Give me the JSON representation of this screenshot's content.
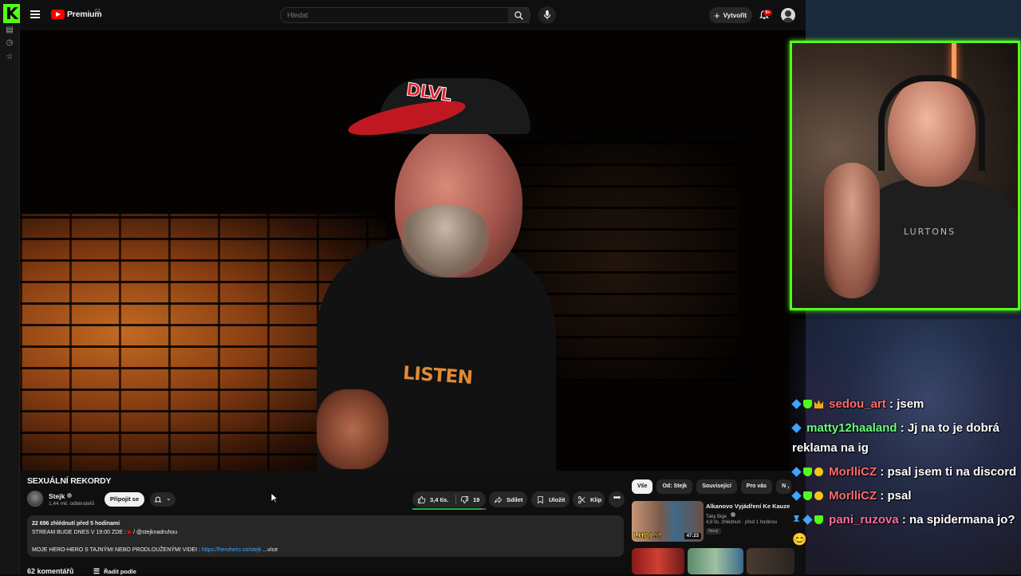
{
  "header": {
    "brand": "Premium",
    "country": "CZ",
    "search_placeholder": "Hledat",
    "create_label": "Vytvořit",
    "notifications_count": "9+"
  },
  "video": {
    "title": "SEXUÁLNÍ REKORDY",
    "overlay_text": {
      "cap_logo": "DLVL",
      "shirt_text": "LISTEN"
    }
  },
  "channel": {
    "name": "Stejk",
    "subscribers": "1,44 mil. odběratelů",
    "subscribe_label": "Připojit se"
  },
  "actions": {
    "likes": "3,4 tis.",
    "like_ratio": 0.95,
    "dislikes": "19",
    "share": "Sdílet",
    "save": "Uložit",
    "clip": "Klip"
  },
  "description": {
    "meta": "22 696 zhlédnutí  před 5 hodinami",
    "line1": "STREAM BUDE DNES V 19:00 ZDE :",
    "line1_link": "/ @stejknadruhou",
    "line2": "MOJE HERO-HERO S TAJNÝMI NEBO PRODLOUŽENÝMI VIDEI :",
    "line2_link": "https://herohero.co/stejk",
    "more": "...více"
  },
  "comments": {
    "count_label": "62 komentářů",
    "sort_label": "Řadit podle"
  },
  "chips": [
    "Vše",
    "Od: Stejk",
    "Související",
    "Pro vás",
    "N"
  ],
  "related": [
    {
      "title": "Alkanovo Vyjádření Ke Kauze",
      "channel": "Taky Bige",
      "views": "4,8 tis. zhlédnutí · před 1 hodinou",
      "badge": "Nový",
      "duration": "47:23",
      "thumb_text": "LHAL!?"
    }
  ],
  "chat": [
    {
      "user": "sedou_art",
      "text": " : jsem",
      "badges": [
        "blue",
        "green",
        "crown"
      ]
    },
    {
      "user": "matty12haaland",
      "text": " : Jj na to je dobrá reklama na ig",
      "badges": [
        "blue"
      ]
    },
    {
      "user": "MorlliCZ",
      "text": " : psal jsem ti na discord",
      "badges": [
        "blue",
        "green",
        "gold"
      ]
    },
    {
      "user": "MorlliCZ",
      "text": " : psal",
      "badges": [
        "blue",
        "green",
        "gold"
      ]
    },
    {
      "user": "pani_ruzova",
      "text": " : na spidermana jo? 😊",
      "badges": [
        "pin",
        "blue",
        "green"
      ]
    }
  ],
  "webcam": {
    "shirt_text": "LURTONS"
  }
}
